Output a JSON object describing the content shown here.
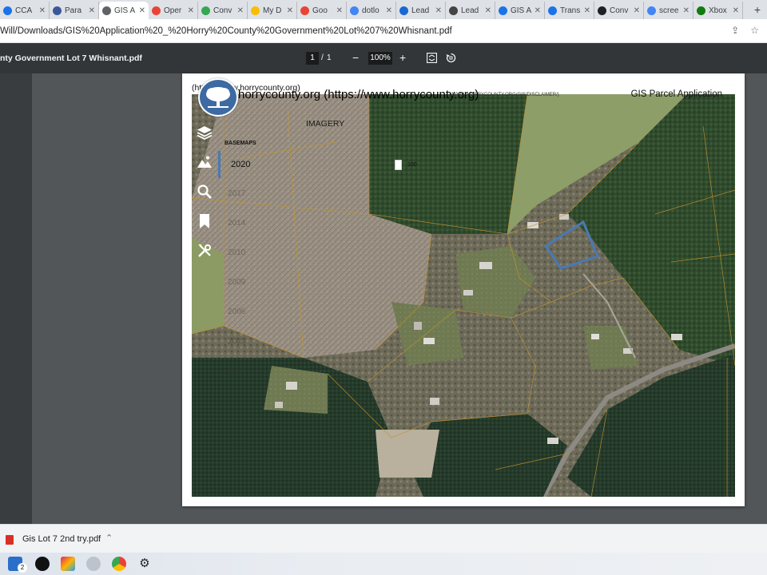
{
  "tabs": [
    {
      "label": "CCA",
      "favicon": "tab-favicon",
      "color": "#1a73e8",
      "active": false
    },
    {
      "label": "Para",
      "favicon": "tab-favicon",
      "color": "#3b5998",
      "active": false
    },
    {
      "label": "GIS A",
      "favicon": "globe-icon",
      "color": "#5f6368",
      "active": true
    },
    {
      "label": "Oper",
      "favicon": "gmail-icon",
      "color": "#ea4335",
      "active": false
    },
    {
      "label": "Conv",
      "favicon": "tab-favicon",
      "color": "#34a853",
      "active": false
    },
    {
      "label": "My D",
      "favicon": "drive-icon",
      "color": "#fbbc04",
      "active": false
    },
    {
      "label": "Goo",
      "favicon": "maps-icon",
      "color": "#ea4335",
      "active": false
    },
    {
      "label": "dotlo",
      "favicon": "tab-favicon",
      "color": "#4285f4",
      "active": false
    },
    {
      "label": "Lead",
      "favicon": "tab-favicon",
      "color": "#1967d2",
      "active": false
    },
    {
      "label": "Lead",
      "favicon": "tab-favicon",
      "color": "#444444",
      "active": false
    },
    {
      "label": "GIS A",
      "favicon": "tab-favicon",
      "color": "#1a73e8",
      "active": false
    },
    {
      "label": "Trans",
      "favicon": "tab-favicon",
      "color": "#1a73e8",
      "active": false
    },
    {
      "label": "Conv",
      "favicon": "tab-favicon",
      "color": "#202124",
      "active": false
    },
    {
      "label": "scree",
      "favicon": "google-icon",
      "color": "#4285f4",
      "active": false
    },
    {
      "label": "Xbox",
      "favicon": "xbox-icon",
      "color": "#107c10",
      "active": false
    }
  ],
  "address_bar": {
    "url": "Will/Downloads/GIS%20Application%20_%20Horry%20County%20Government%20Lot%207%20Whisnant.pdf"
  },
  "pdf_toolbar": {
    "title": "nty Government Lot 7 Whisnant.pdf",
    "current_page": "1",
    "separator": "/",
    "total_pages": "1",
    "zoom": "100%",
    "zoom_out": "−",
    "zoom_in": "+"
  },
  "document": {
    "header_url_small": "(https://www.horrycounty.org)",
    "header_url_large": "horrycounty.org (https://www.horrycounty.org)",
    "header_disclaimer": "(WWW.HORRYCOUNTY.ORG/GIS/DISCLAIMER/)",
    "app_title": "GIS Parcel Application",
    "panel": {
      "heading": "IMAGERY",
      "section": "BASEMAPS",
      "active_year": "2020",
      "years": [
        "2017",
        "2014",
        "2010",
        "2009",
        "2006",
        "2005",
        "2001"
      ],
      "opacity_value": "100"
    },
    "tools": [
      "layers-icon",
      "basemap-icon",
      "search-icon",
      "bookmark-icon",
      "tools-icon"
    ]
  },
  "downloads": {
    "filename": "Gis Lot 7 2nd try.pdf"
  },
  "taskbar": {
    "badge": "2"
  },
  "colors": {
    "parcel_highlight": "#4a79b5",
    "pdf_toolbar": "#323639",
    "viewer_bg": "#525659"
  }
}
